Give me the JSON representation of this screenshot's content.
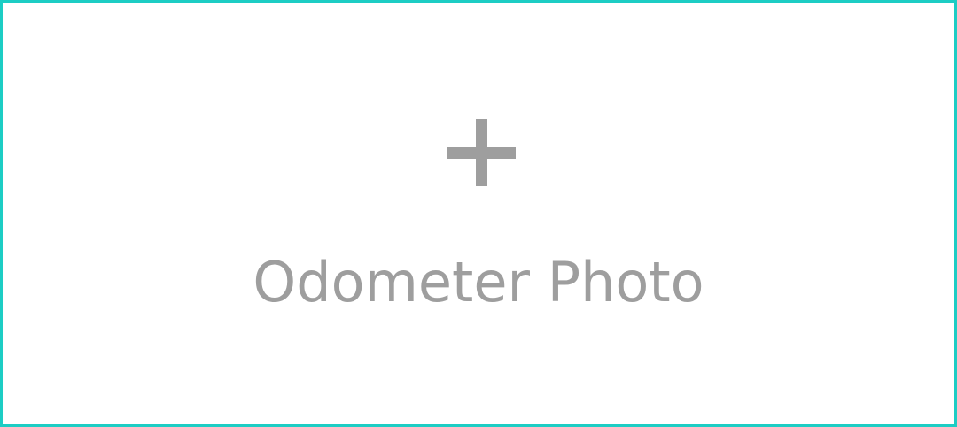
{
  "upload_tile": {
    "icon": "plus-icon",
    "label": "Odometer Photo",
    "border_color": "#1ccdc4",
    "text_color": "#9e9e9e"
  }
}
